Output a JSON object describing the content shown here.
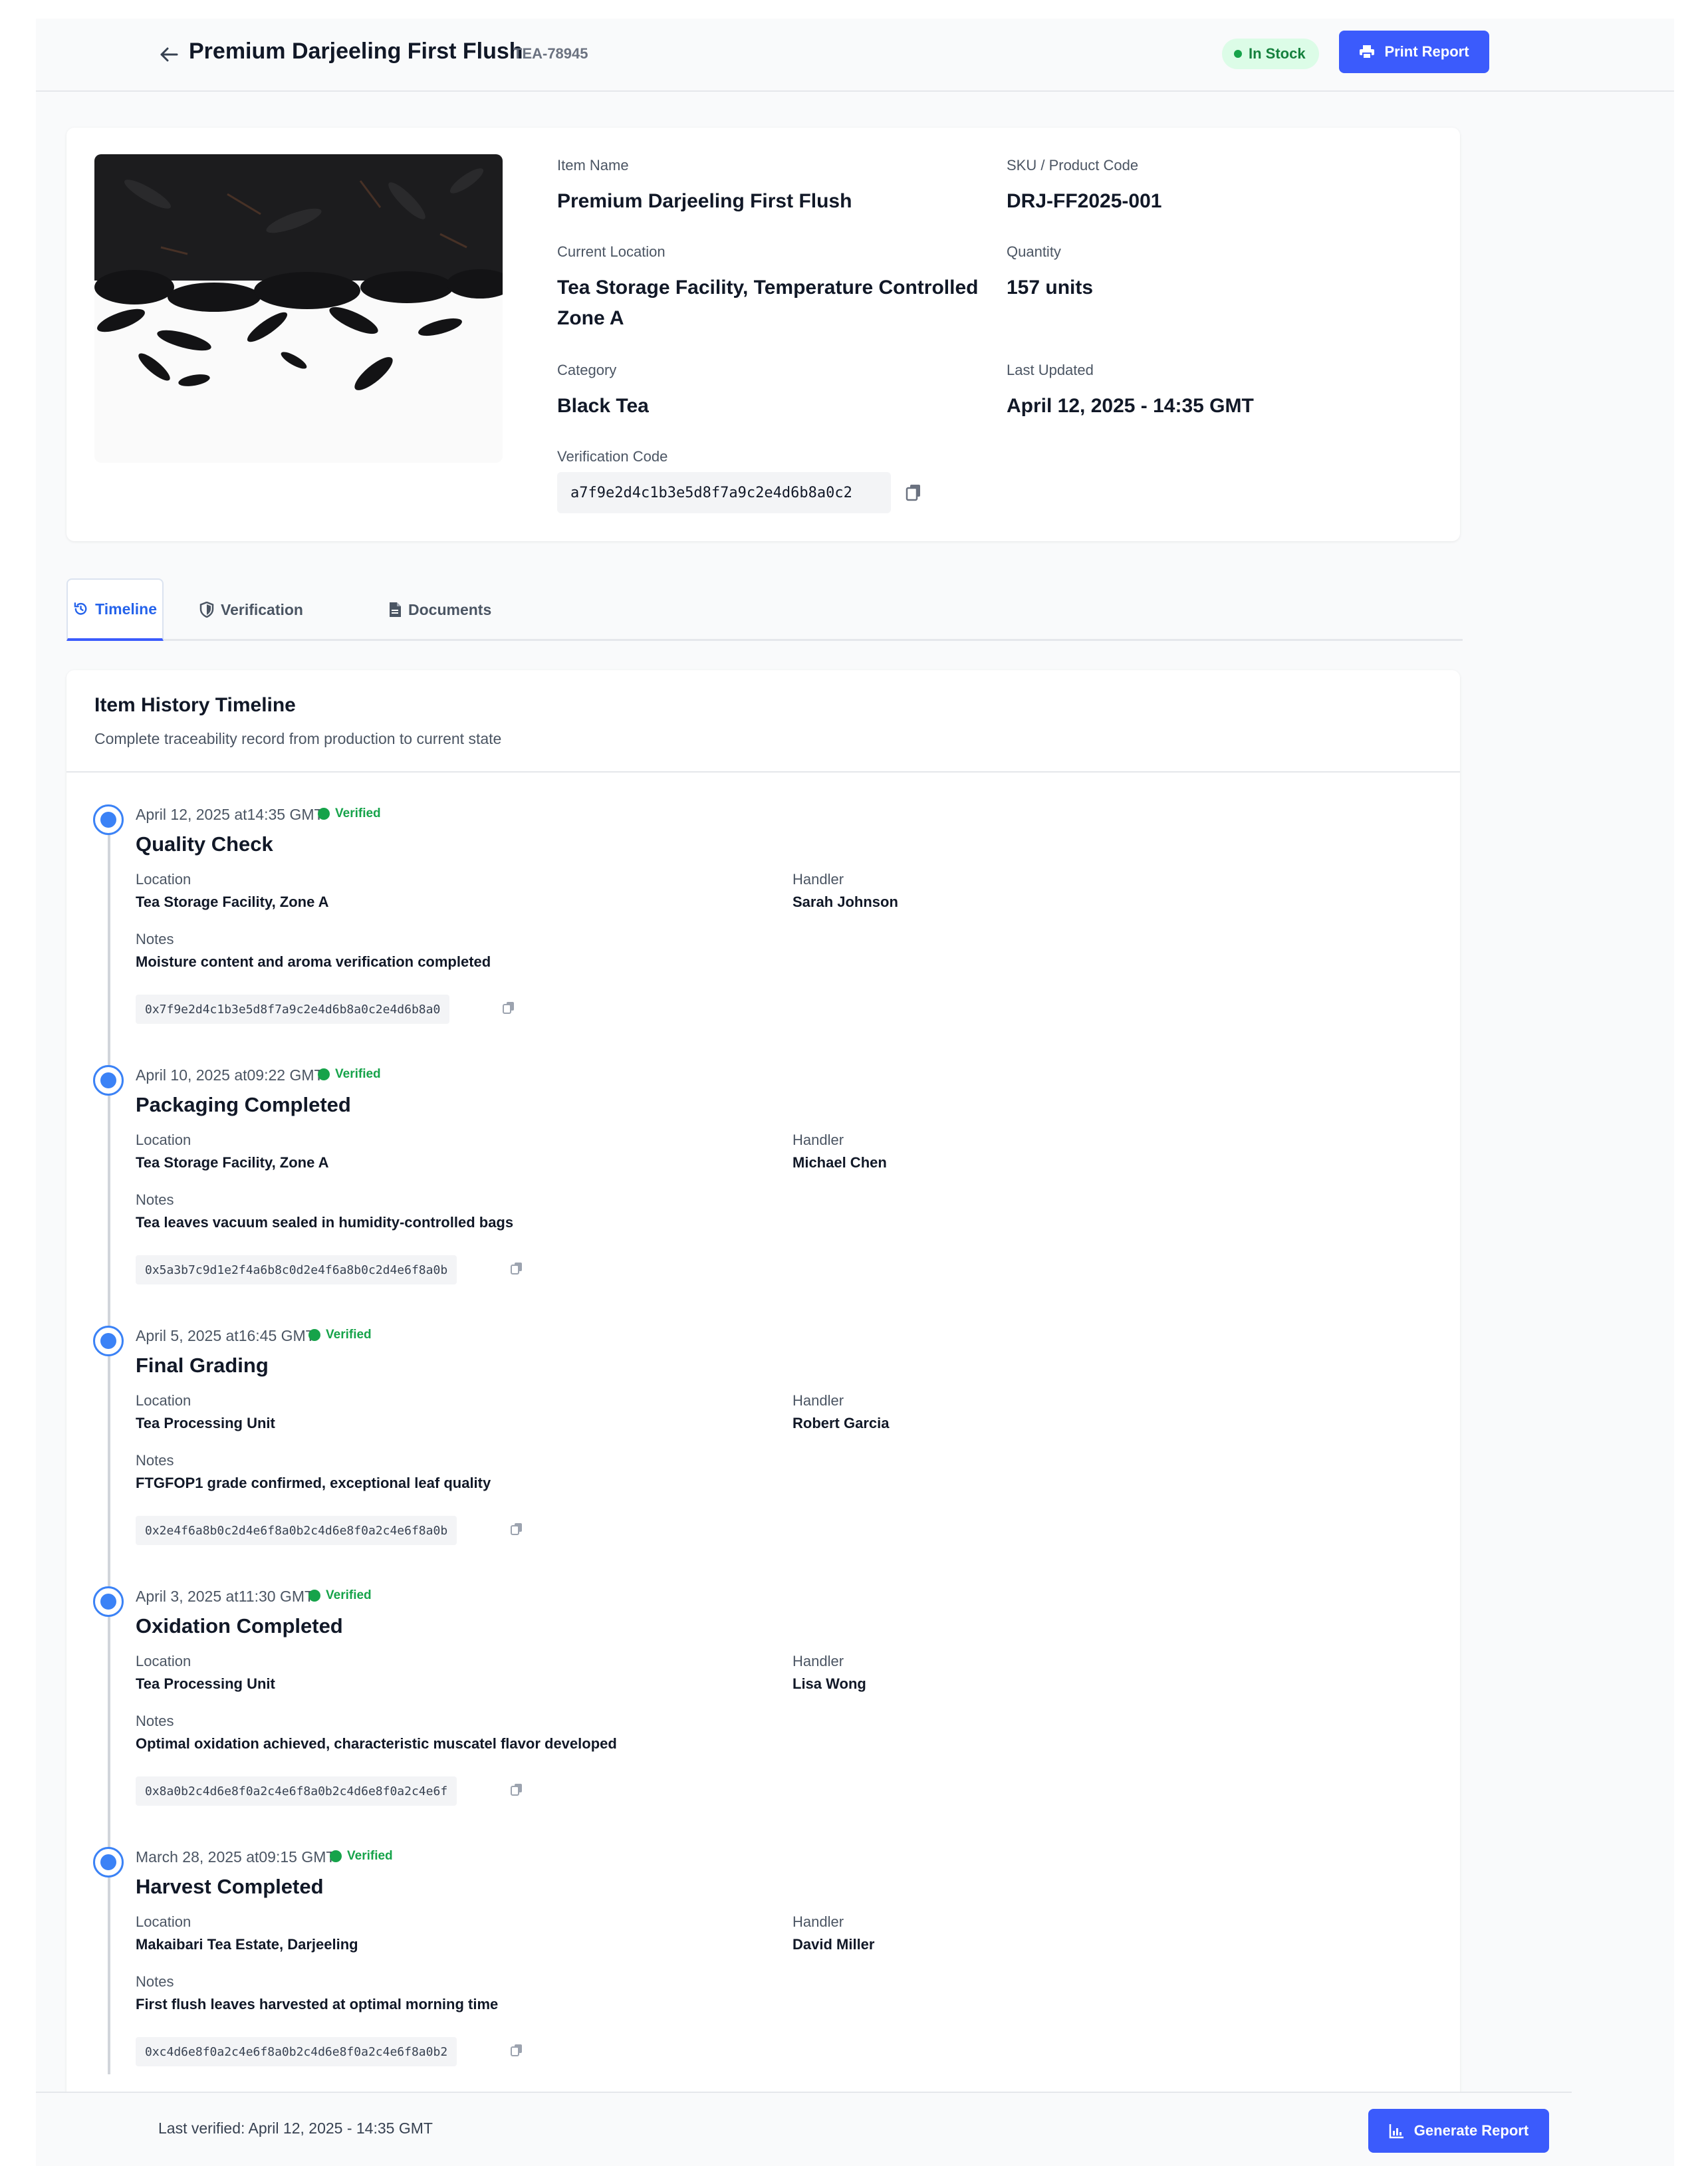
{
  "header": {
    "title": "Premium Darjeeling First Flush",
    "item_id": "TEA-78945",
    "status": "In Stock",
    "print_label": "Print Report"
  },
  "item": {
    "fields": {
      "item_name": {
        "label": "Item Name",
        "value": "Premium Darjeeling First Flush"
      },
      "sku": {
        "label": "SKU / Product Code",
        "value": "DRJ-FF2025-001"
      },
      "location": {
        "label": "Current Location",
        "value": "Tea Storage Facility, Temperature Controlled Zone A"
      },
      "quantity": {
        "label": "Quantity",
        "value": "157 units"
      },
      "category": {
        "label": "Category",
        "value": "Black Tea"
      },
      "last_updated": {
        "label": "Last Updated",
        "value": "April 12, 2025 - 14:35 GMT"
      },
      "verification": {
        "label": "Verification Code",
        "value": "a7f9e2d4c1b3e5d8f7a9c2e4d6b8a0c2"
      }
    }
  },
  "tabs": [
    {
      "label": "Timeline",
      "active": true,
      "icon": "history-icon"
    },
    {
      "label": "Verification",
      "active": false,
      "icon": "shield-icon"
    },
    {
      "label": "Documents",
      "active": false,
      "icon": "document-icon"
    }
  ],
  "timeline": {
    "title": "Item History Timeline",
    "subtitle": "Complete traceability record from production to current state",
    "location_label": "Location",
    "handler_label": "Handler",
    "notes_label": "Notes",
    "verified_label": "Verified",
    "events": [
      {
        "date": "April 12, 2025 at14:35 GMT",
        "title": "Quality Check",
        "location": "Tea Storage Facility, Zone A",
        "handler": "Sarah Johnson",
        "notes": "Moisture content and aroma verification completed",
        "hash": "0x7f9e2d4c1b3e5d8f7a9c2e4d6b8a0c2e4d6b8a0"
      },
      {
        "date": "April 10, 2025 at09:22 GMT",
        "title": "Packaging Completed",
        "location": "Tea Storage Facility, Zone A",
        "handler": "Michael Chen",
        "notes": "Tea leaves vacuum sealed in humidity-controlled bags",
        "hash": "0x5a3b7c9d1e2f4a6b8c0d2e4f6a8b0c2d4e6f8a0b"
      },
      {
        "date": "April 5, 2025 at16:45 GMT",
        "title": "Final Grading",
        "location": "Tea Processing Unit",
        "handler": "Robert Garcia",
        "notes": "FTGFOP1 grade confirmed, exceptional leaf quality",
        "hash": "0x2e4f6a8b0c2d4e6f8a0b2c4d6e8f0a2c4e6f8a0b"
      },
      {
        "date": "April 3, 2025 at11:30 GMT",
        "title": "Oxidation Completed",
        "location": "Tea Processing Unit",
        "handler": "Lisa Wong",
        "notes": "Optimal oxidation achieved, characteristic muscatel flavor developed",
        "hash": "0x8a0b2c4d6e8f0a2c4e6f8a0b2c4d6e8f0a2c4e6f"
      },
      {
        "date": "March 28, 2025 at09:15 GMT",
        "title": "Harvest Completed",
        "location": "Makaibari Tea Estate, Darjeeling",
        "handler": "David Miller",
        "notes": "First flush leaves harvested at optimal morning time",
        "hash": "0xc4d6e8f0a2c4e6f8a0b2c4d6e8f0a2c4e6f8a0b2"
      }
    ]
  },
  "footer": {
    "last_verified": "Last verified: April 12, 2025 - 14:35 GMT",
    "generate_label": "Generate Report"
  },
  "colors": {
    "primary": "#3b5bfc",
    "success": "#16a34a",
    "timeline_dot": "#3b82f6"
  }
}
